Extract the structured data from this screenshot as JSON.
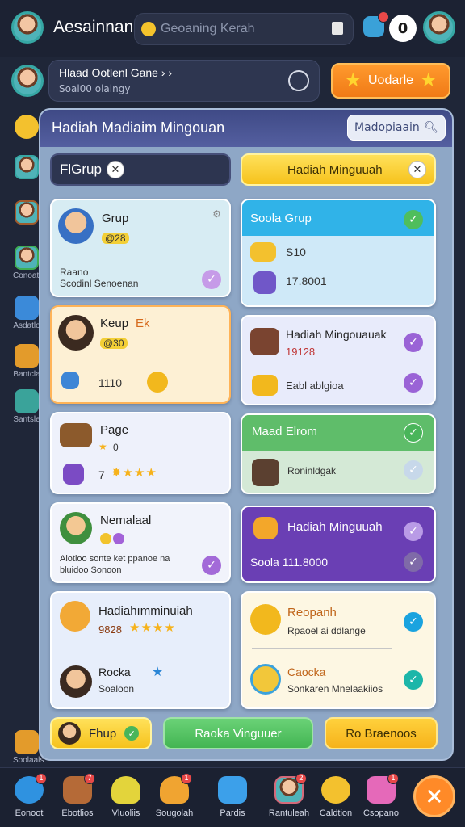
{
  "header": {
    "app_title": "Aesainnan",
    "search_placeholder": "Geoaning Kerah",
    "notification_badge": "",
    "profile_initial": "0"
  },
  "userbar": {
    "name": "Hlaad Ootlenl Gane ›  ›",
    "sub": "Soal00 olaingy",
    "upgrade_label": "Uodarle"
  },
  "left_rail": [
    {
      "label": ""
    },
    {
      "label": ""
    },
    {
      "label": ""
    },
    {
      "label": "Conoats"
    },
    {
      "label": "Asdatlo"
    },
    {
      "label": "Bantcla"
    },
    {
      "label": "Santsle"
    },
    {
      "label": "Soolaals"
    }
  ],
  "panel": {
    "title": "Hadiah Madiaim Mingouan",
    "search_label": "Madopiaain",
    "filter_left": "FlGrup",
    "filter_right": "Hadiah Minguuah",
    "left_cards": [
      {
        "title": "Grup",
        "line1": "@28",
        "line2": "Raano",
        "line3": "Scodinl Senoenan"
      },
      {
        "title": "Keup",
        "title_accent": "Ek",
        "line1": "@30",
        "line2": "1110"
      },
      {
        "title": "Page",
        "line1": "0",
        "line2": "7"
      },
      {
        "title": "Nemalaal",
        "line1": "",
        "line2": "Alotioo sonte ket ppanoe na",
        "line3": "bluidoo Sonoon"
      },
      {
        "title": "Hadiahımminuiah",
        "line1": "9828",
        "line2": "Rocka",
        "line3": "Soaloon"
      }
    ],
    "right_cards": [
      {
        "title": "Soola Grup",
        "line1": "S10",
        "line2": "17.8001"
      },
      {
        "title": "Hadiah Mingouauak",
        "line1": "19128",
        "line2": "Eabl ablgioa"
      },
      {
        "title": "Maad Elrom",
        "line1": "Roninldgak"
      },
      {
        "title": "Hadiah Minguuah",
        "line1": "Soola 111.8000"
      },
      {
        "title": "Reopanh",
        "line1": "Rpaoel ai ddlange",
        "line2": "Caocka",
        "line3": "Sonkaren Mnelaakiios"
      }
    ],
    "footer_buttons": [
      "Fhup",
      "Raoka Vinguuer",
      "Ro Braenoos"
    ]
  },
  "bottom_nav": [
    {
      "label": "Eonoot",
      "badge": "1"
    },
    {
      "label": "Ebotlios",
      "badge": "7"
    },
    {
      "label": "Vluoliis",
      "badge": ""
    },
    {
      "label": "Sougolah",
      "badge": "1"
    },
    {
      "label": "Pardis",
      "badge": ""
    },
    {
      "label": "Rantuleah",
      "badge": "2"
    },
    {
      "label": "Caldtion",
      "badge": ""
    },
    {
      "label": "Csopano",
      "badge": "1"
    }
  ],
  "colors": {
    "accent_orange": "#f07a16",
    "check_purple": "#9a63d6",
    "check_green": "#49b55a",
    "check_blue": "#1aa3df",
    "check_teal": "#1db6a9"
  }
}
